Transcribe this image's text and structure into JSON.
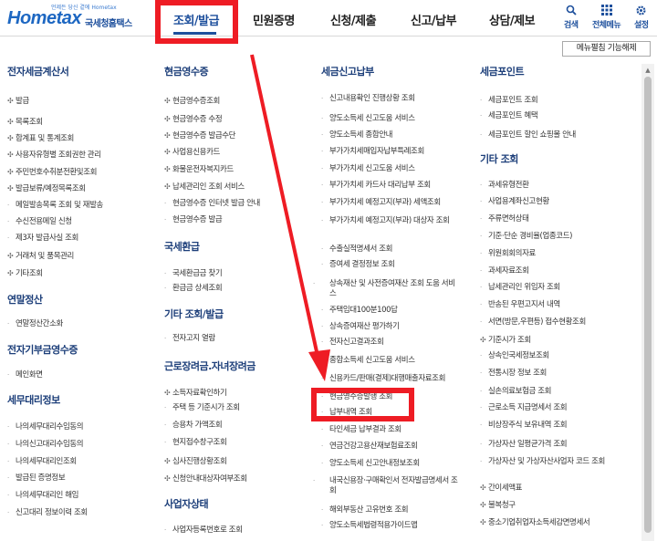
{
  "header": {
    "logo_text": "Hometax",
    "logo_tagline": "언제든 당신 곁에 Hometax",
    "agency": "국세청홈택스",
    "nav": [
      "조회/발급",
      "민원증명",
      "신청/제출",
      "신고/납부",
      "상담/제보"
    ],
    "util": [
      {
        "label": "검색",
        "icon": "search-icon"
      },
      {
        "label": "전체메뉴",
        "icon": "grid-icon"
      },
      {
        "label": "설정",
        "icon": "gear-icon"
      }
    ]
  },
  "edit_button": "메뉴펼침 기능해제",
  "col1": {
    "sections": [
      {
        "title": "전자세금계산서",
        "items": [
          {
            "label": "발급",
            "bullet": "plus"
          },
          {
            "label": "목록조회",
            "bullet": "plus"
          },
          {
            "label": "합계표 및 통계조회",
            "bullet": "plus"
          },
          {
            "label": "사용자유형별 조회권한 관리",
            "bullet": "plus"
          },
          {
            "label": "주민번호수취분전환및조회",
            "bullet": "plus"
          },
          {
            "label": "발급보류/예정목록조회",
            "bullet": "plus"
          },
          {
            "label": "메일발송목록 조회 및 재발송",
            "bullet": "dot"
          },
          {
            "label": "수신전용메일 신청",
            "bullet": "dot"
          },
          {
            "label": "제3자 발급사실 조회",
            "bullet": "dot"
          },
          {
            "label": "거래처 및 품목관리",
            "bullet": "plus"
          },
          {
            "label": "기타조회",
            "bullet": "plus"
          }
        ]
      },
      {
        "title": "연말정산",
        "items": [
          {
            "label": "연말정산간소화",
            "bullet": "dot"
          }
        ]
      },
      {
        "title": "전자기부금영수증",
        "items": [
          {
            "label": "메인화면",
            "bullet": "dot"
          }
        ]
      },
      {
        "title": "세무대리정보",
        "items": [
          {
            "label": "나의세무대리수임동의",
            "bullet": "dot"
          },
          {
            "label": "나의신고대리수임동의",
            "bullet": "dot"
          },
          {
            "label": "나의세무대리인조회",
            "bullet": "dot"
          },
          {
            "label": "발급된 증명정보",
            "bullet": "dot"
          },
          {
            "label": "나의세무대리인 해임",
            "bullet": "dot"
          },
          {
            "label": "신고대리 정보이력 조회",
            "bullet": "dot"
          }
        ]
      }
    ]
  },
  "col2": {
    "sections": [
      {
        "title": "현금영수증",
        "items": [
          {
            "label": "현금영수증조회",
            "bullet": "plus"
          },
          {
            "label": "현금영수증 수정",
            "bullet": "plus"
          },
          {
            "label": "현금영수증 발급수단",
            "bullet": "plus"
          },
          {
            "label": "사업용신용카드",
            "bullet": "plus"
          },
          {
            "label": "화물운전자복지카드",
            "bullet": "plus"
          },
          {
            "label": "납세관리인 조회 서비스",
            "bullet": "plus"
          },
          {
            "label": "현금영수증 인터넷 발급 안내",
            "bullet": "dot"
          },
          {
            "label": "현금영수증 발급",
            "bullet": "dot"
          }
        ]
      },
      {
        "title": "국세환급",
        "items": [
          {
            "label": "국세환급금 찾기",
            "bullet": "dot"
          },
          {
            "label": "환급금 상세조회",
            "bullet": "dot"
          }
        ]
      },
      {
        "title": "기타 조회/발급",
        "items": [
          {
            "label": "전자고지 열람",
            "bullet": "dot"
          }
        ]
      },
      {
        "title": "근로장려금.자녀장려금",
        "items": [
          {
            "label": "소득자료확인하기",
            "bullet": "plus"
          },
          {
            "label": "주택 등 기준시가 조회",
            "bullet": "dot"
          },
          {
            "label": "승용차 가액조회",
            "bullet": "dot"
          },
          {
            "label": "현지접수창구조회",
            "bullet": "dot"
          },
          {
            "label": "심사진행상황조회",
            "bullet": "plus"
          },
          {
            "label": "신청안내대상자여부조회",
            "bullet": "plus"
          }
        ]
      },
      {
        "title": "사업자상태",
        "items": [
          {
            "label": "사업자등록번호로 조회",
            "bullet": "dot"
          }
        ]
      }
    ]
  },
  "col3": {
    "sections": [
      {
        "title": "세금신고납부",
        "items": [
          {
            "label": "신고내용확인 진행상황 조회",
            "bullet": "dot"
          },
          {
            "label": "양도소득세 신고도움 서비스",
            "bullet": "dot"
          },
          {
            "label": "양도소득세 종합안내",
            "bullet": "dot"
          },
          {
            "label": "부가가치세매입자납부특례조회",
            "bullet": "dot"
          },
          {
            "label": "부가가치세 신고도움 서비스",
            "bullet": "dot"
          },
          {
            "label": "부가가치세 카드사 대리납부 조회",
            "bullet": "dot"
          },
          {
            "label": "부가가치세 예정고지(부과) 세액조회",
            "bullet": "dot"
          },
          {
            "label": "부가가치세 예정고지(부과) 대상자 조회",
            "bullet": "dot"
          },
          {
            "label": "수출실적명세서 조회",
            "bullet": "dot"
          },
          {
            "label": "증여세 결정정보 조회",
            "bullet": "dot"
          },
          {
            "label": "상속재산 및 사전증여재산 조회 도움 서비스",
            "bullet": "dot"
          },
          {
            "label": "주택임대100분100답",
            "bullet": "dot"
          },
          {
            "label": "상속증여재산 평가하기",
            "bullet": "dot"
          },
          {
            "label": "전자신고결과조회",
            "bullet": "dot"
          },
          {
            "label": "종합소득세 신고도움 서비스",
            "bullet": "dot"
          },
          {
            "label": "신용카드/판매(결제)대행매출자료조회",
            "bullet": "dot"
          },
          {
            "label": "현금영수증발행 조회",
            "bullet": "dot"
          },
          {
            "label": "납부내역 조회",
            "bullet": "dot"
          },
          {
            "label": "타인세금 납부결과 조회",
            "bullet": "dot"
          },
          {
            "label": "연금건강고용산재보험료조회",
            "bullet": "dot"
          },
          {
            "label": "양도소득세 신고안내정보조회",
            "bullet": "dot"
          },
          {
            "label": "내국신용장·구매확인서 전자발급명세서 조회",
            "bullet": "dot"
          },
          {
            "label": "해외부동산 고유번호 조회",
            "bullet": "dot"
          },
          {
            "label": "양도소득세법령적용가이드맵",
            "bullet": "dot"
          }
        ]
      }
    ]
  },
  "col4": {
    "sections": [
      {
        "title": "세금포인트",
        "items": [
          {
            "label": "세금포인트 조회",
            "bullet": "dot"
          },
          {
            "label": "세금포인트 혜택",
            "bullet": "dot"
          },
          {
            "label": "세금포인트 할인 쇼핑몰 안내",
            "bullet": "dot"
          }
        ]
      },
      {
        "title": "기타 조회",
        "items": [
          {
            "label": "과세유형전환",
            "bullet": "dot"
          },
          {
            "label": "사업용계좌신고현황",
            "bullet": "dot"
          },
          {
            "label": "주류면허상태",
            "bullet": "dot"
          },
          {
            "label": "기준·단순 경비율(업종코드)",
            "bullet": "dot"
          },
          {
            "label": "위원회회의자료",
            "bullet": "dot"
          },
          {
            "label": "과세자료조회",
            "bullet": "dot"
          },
          {
            "label": "납세관리인 위임자 조회",
            "bullet": "dot"
          },
          {
            "label": "반송된 우편고지서 내역",
            "bullet": "dot"
          },
          {
            "label": "서면(방문,우편등) 접수현황조회",
            "bullet": "dot"
          },
          {
            "label": "기준시가 조회",
            "bullet": "plus"
          },
          {
            "label": "상속인국세정보조회",
            "bullet": "dot"
          },
          {
            "label": "전통시장 정보 조회",
            "bullet": "dot"
          },
          {
            "label": "실손의료보험금 조회",
            "bullet": "dot"
          },
          {
            "label": "근로소득 지급명세서 조회",
            "bullet": "dot"
          },
          {
            "label": "비상장주식 보유내역 조회",
            "bullet": "dot"
          },
          {
            "label": "가상자산 일평균가격 조회",
            "bullet": "dot"
          },
          {
            "label": "가상자산 및 가상자산사업자 코드 조회",
            "bullet": "dot"
          },
          {
            "label": "간이세액표",
            "bullet": "plus"
          },
          {
            "label": "불복청구",
            "bullet": "plus"
          },
          {
            "label": "중소기업취업자소득세감면명세서",
            "bullet": "plus"
          }
        ]
      }
    ]
  },
  "annotation_color": "#ee1c24",
  "accent_color": "#1d4f9c"
}
